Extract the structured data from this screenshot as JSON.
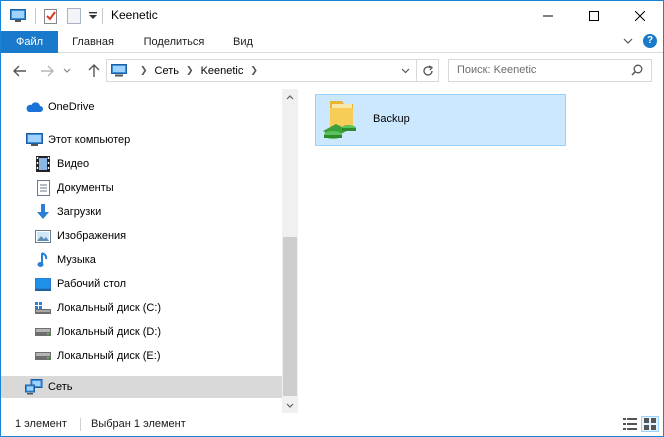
{
  "window": {
    "title": "Keenetic"
  },
  "quick_access": {
    "icons": [
      "computer-icon",
      "properties-icon",
      "new-folder-icon",
      "customize-dropdown-icon"
    ]
  },
  "ribbon": {
    "tabs": [
      {
        "label": "Файл",
        "active": true
      },
      {
        "label": "Главная"
      },
      {
        "label": "Поделиться"
      },
      {
        "label": "Вид"
      }
    ],
    "help_label": "?"
  },
  "address": {
    "breadcrumbs": [
      "Сеть",
      "Keenetic"
    ],
    "search_placeholder": "Поиск: Keenetic"
  },
  "nav": {
    "items": [
      {
        "label": "OneDrive",
        "icon": "onedrive-icon"
      },
      {
        "label": "Этот компьютер",
        "icon": "this-pc-icon"
      },
      {
        "label": "Видео",
        "icon": "video-icon"
      },
      {
        "label": "Документы",
        "icon": "documents-icon"
      },
      {
        "label": "Загрузки",
        "icon": "downloads-icon"
      },
      {
        "label": "Изображения",
        "icon": "pictures-icon"
      },
      {
        "label": "Музыка",
        "icon": "music-icon"
      },
      {
        "label": "Рабочий стол",
        "icon": "desktop-icon"
      },
      {
        "label": "Локальный диск (C:)",
        "icon": "system-drive-icon"
      },
      {
        "label": "Локальный диск (D:)",
        "icon": "drive-icon"
      },
      {
        "label": "Локальный диск (E:)",
        "icon": "drive-icon"
      },
      {
        "label": "Сеть",
        "icon": "network-icon",
        "selected": true
      }
    ]
  },
  "content": {
    "items": [
      {
        "label": "Backup",
        "icon": "shared-folder-icon",
        "selected": true
      }
    ]
  },
  "status": {
    "count": "1 элемент",
    "selection": "Выбран 1 элемент"
  },
  "colors": {
    "accent": "#1979ca",
    "selection_fill": "#cce8ff",
    "selection_border": "#99d1ff",
    "nav_selected": "#d9d9d9"
  }
}
